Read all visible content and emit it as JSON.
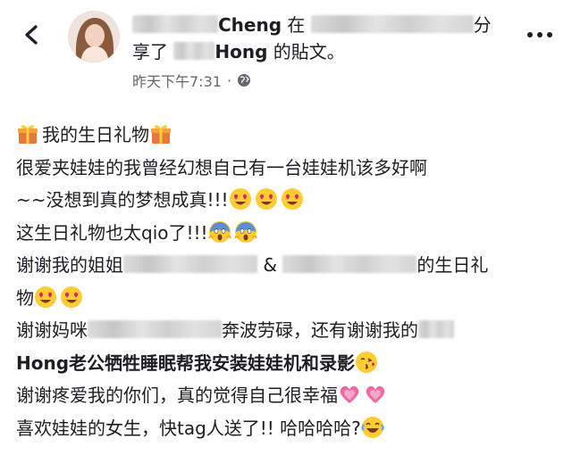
{
  "header": {
    "author_suffix": "Cheng",
    "word_in": "在",
    "word_fen": "分",
    "word_share": "享了",
    "shared_name": "Hong",
    "shared_suffix": "的貼文。",
    "timestamp": "昨天下午7:31",
    "separator": "·",
    "icons": {
      "back": "chevron-left-icon",
      "privacy": "globe-icon",
      "more": "more-horizontal-icon"
    }
  },
  "post": {
    "line1_text": "我的生日礼物",
    "line2_text": "很爱夹娃娃的我曾经幻想自己有一台娃娃机该多好啊",
    "line3_text": "~~没想到真的梦想成真!!!",
    "line4_text": "这生日礼物也太qio了!!!",
    "line5_a": "谢谢我的姐姐",
    "line5_amp": "&",
    "line5_b": "的生日礼",
    "line6_text": "物",
    "line7_a": "谢谢妈咪",
    "line7_b": "奔波劳碌，还有谢谢我的",
    "line8_text": "Hong老公牺牲睡眠帮我安装娃娃机和录影",
    "line9_text": "谢谢疼爱我的你们，真的觉得自己很幸福",
    "line10_text": "喜欢娃娃的女生，快tag人送了!! 哈哈哈哈?",
    "emoji_names": [
      "gift-emoji",
      "heart-eyes-emoji",
      "screaming-face-emoji",
      "kissing-heart-emoji",
      "growing-heart-emoji",
      "tears-of-joy-emoji"
    ]
  },
  "colors": {
    "text": "#1c1e21",
    "meta": "#65676b",
    "background": "#ffffff"
  }
}
